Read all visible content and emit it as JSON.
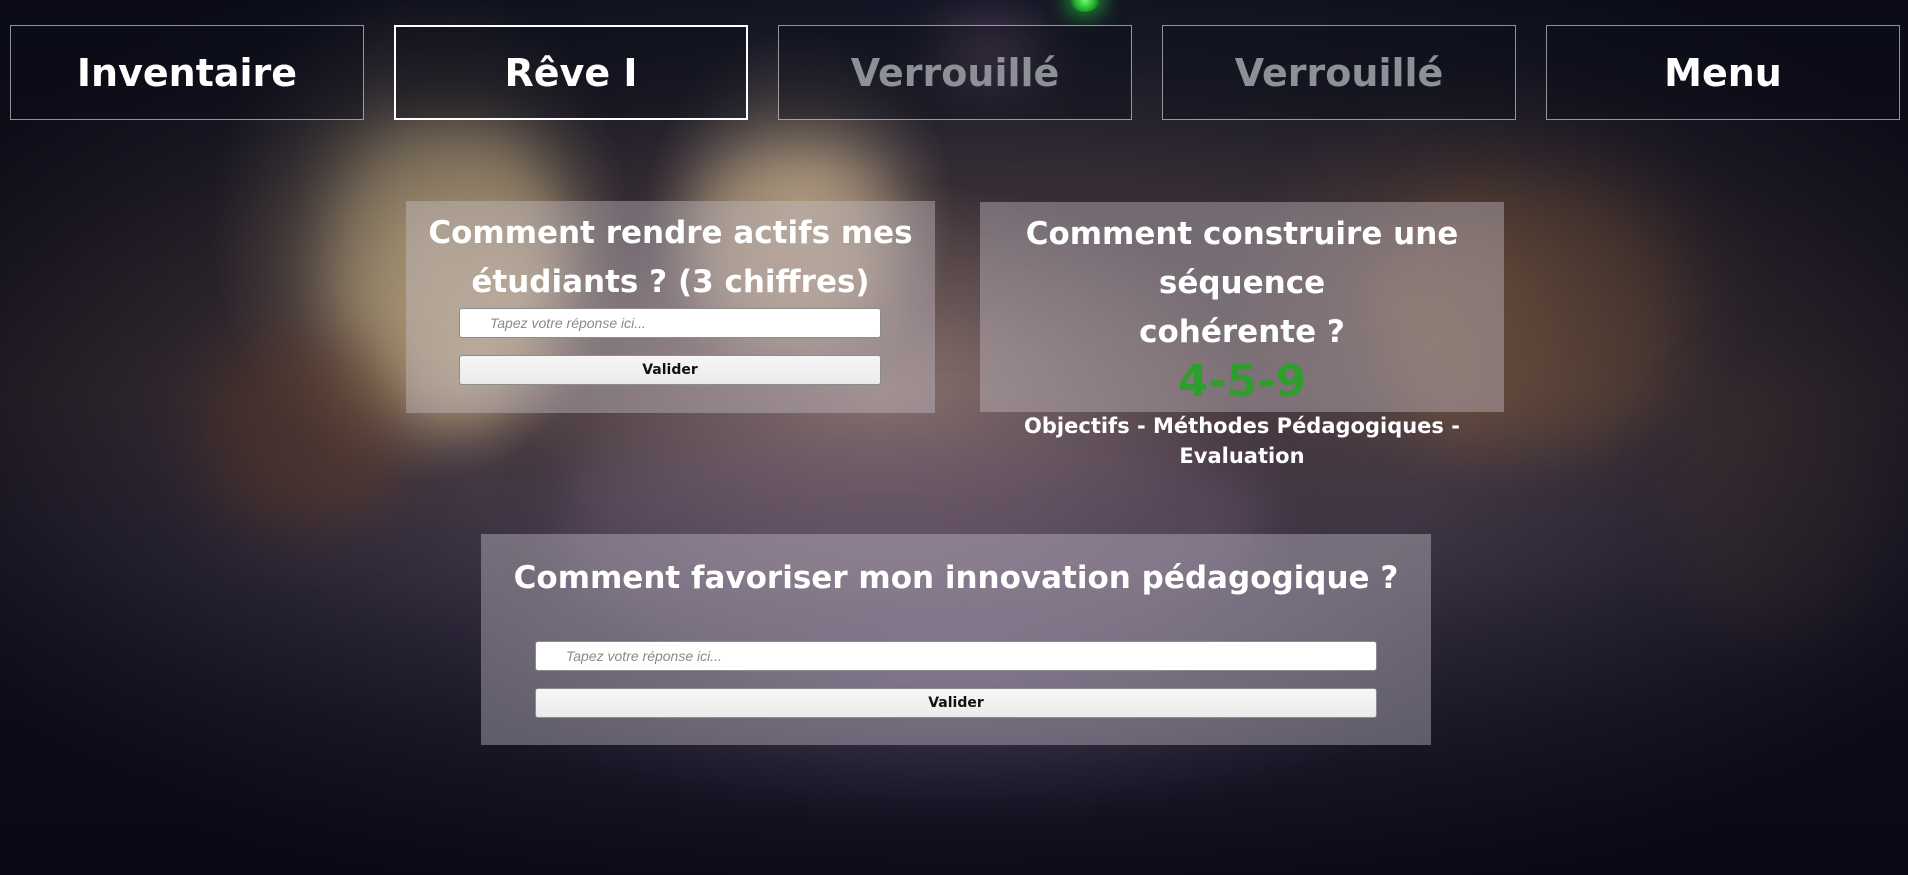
{
  "nav": {
    "tabs": [
      {
        "label": "Inventaire",
        "state": "normal"
      },
      {
        "label": "Rêve I",
        "state": "active"
      },
      {
        "label": "Verrouillé",
        "state": "locked"
      },
      {
        "label": "Verrouillé",
        "state": "locked"
      },
      {
        "label": "Menu",
        "state": "normal"
      }
    ]
  },
  "puzzles": {
    "p1": {
      "question_line1": "Comment rendre actifs mes",
      "question_line2": "étudiants ? (3 chiffres)",
      "input_placeholder": "Tapez votre réponse ici...",
      "submit_label": "Valider"
    },
    "p2": {
      "question_line1": "Comment construire une séquence",
      "question_line2": "cohérente ?",
      "solved_code": "4-5-9",
      "hint": "Objectifs - Méthodes Pédagogiques -Evaluation"
    },
    "p3": {
      "question": "Comment favoriser mon innovation pédagogique ?",
      "input_placeholder": "Tapez votre réponse ici...",
      "submit_label": "Valider"
    }
  },
  "colors": {
    "solved_code": "#2f9e2f",
    "locked_text": "#8e9098",
    "panel_text": "#ffffff",
    "status_light": "#3bd23b"
  }
}
